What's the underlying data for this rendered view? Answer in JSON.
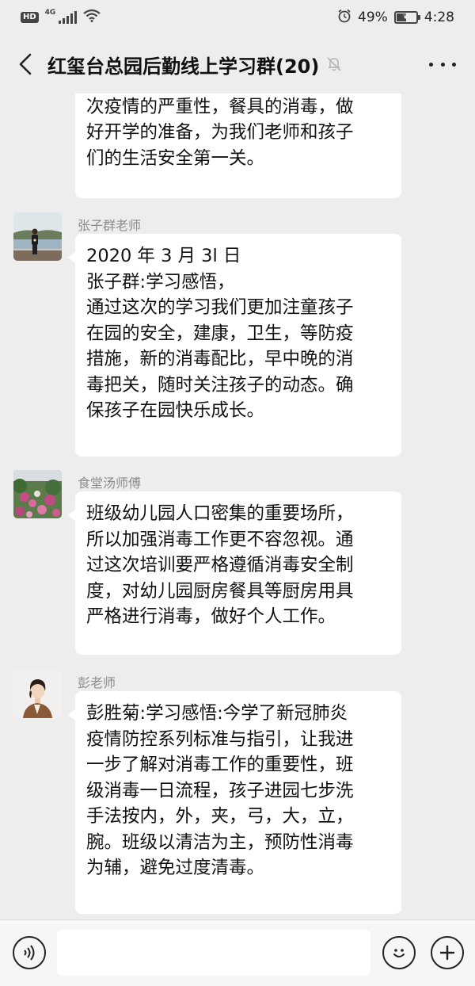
{
  "status_bar": {
    "hd_label": "HD",
    "network_label": "4G",
    "battery_percent": "49%",
    "battery_level": 0.49,
    "time": "4:28",
    "icons": [
      "hd-icon",
      "signal-icon",
      "wifi-icon",
      "alarm-icon",
      "battery-icon"
    ]
  },
  "header": {
    "back_icon": "chevron-left-icon",
    "title": "红玺台总园后勤线上学习群(20)",
    "mute_icon": "bell-muted-icon",
    "more_icon": "more-icon"
  },
  "messages": [
    {
      "sender": "",
      "avatar": "",
      "text": "通过这次学习，我学到了，这\n次疫情的严重性，餐具的消毒，做\n好开学的准备，为我们老师和孩子\n们的生活安全第一关。"
    },
    {
      "sender": "张子群老师",
      "avatar": "lake-photo-avatar",
      "text": "2020 年 3 月 3l 日\n张子群:学习感悟，\n通过这次的学习我们更加注童孩子\n在园的安全，建康，卫生，等防疫\n措施，新的消毒配比，早中晚的消\n毒把关，随时关注孩子的动态。确\n保孩子在园快乐成长。"
    },
    {
      "sender": "食堂汤师傅",
      "avatar": "flower-photo-avatar",
      "text": "班级幼儿园人口密集的重要场所，\n所以加强消毒工作更不容忽视。通\n过这次培训要严格遵循消毒安全制\n度，对幼儿园厨房餐具等厨房用具\n严格进行消毒，做好个人工作。"
    },
    {
      "sender": "彭老师",
      "avatar": "portrait-photo-avatar",
      "text": "彭胜菊:学习感悟:今学了新冠肺炎\n疫情防控系列标准与指引，让我进\n一步了解对消毒工作的重要性，班\n级消毒一日流程，孩子进园七步洗\n手法按内，外，夹，弓，大，立，\n腕。班级以清洁为主，预防性消毒\n为辅，避免过度清毒。"
    }
  ],
  "input_bar": {
    "voice_icon": "voice-icon",
    "input_value": "",
    "emoji_icon": "emoji-icon",
    "plus_icon": "plus-icon"
  }
}
